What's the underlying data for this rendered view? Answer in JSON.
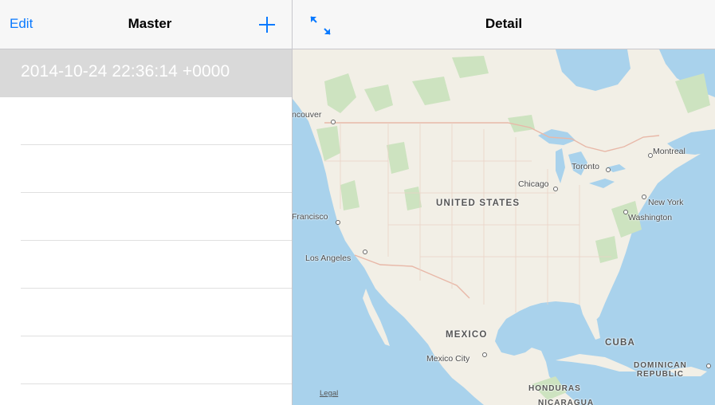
{
  "master": {
    "edit_label": "Edit",
    "title": "Master",
    "add_icon": "plus-icon",
    "rows": [
      {
        "label": "2014-10-24 22:36:14 +0000",
        "selected": true
      },
      {
        "label": ""
      },
      {
        "label": ""
      },
      {
        "label": ""
      },
      {
        "label": ""
      },
      {
        "label": ""
      },
      {
        "label": ""
      }
    ]
  },
  "detail": {
    "title": "Detail",
    "expand_icon": "expand-arrows-icon",
    "map": {
      "cities": {
        "vancouver": "ncouver",
        "montreal": "Montreal",
        "toronto": "Toronto",
        "chicago": "Chicago",
        "new_york": "New York",
        "washington": "Washington",
        "san_francisco": "Francisco",
        "los_angeles": "Los Angeles",
        "mexico_city": "Mexico City"
      },
      "countries": {
        "us": "UNITED STATES",
        "mexico": "MEXICO",
        "cuba": "CUBA",
        "dominican_line1": "DOMINICAN",
        "dominican_line2": "REPUBLIC",
        "honduras": "HONDURAS",
        "nicaragua": "NICARAGUA"
      },
      "legal_label": "Legal"
    }
  },
  "colors": {
    "tint": "#0a7aff",
    "selection": "#d9d9d9",
    "ocean": "#a9d2ec",
    "land": "#f2efe6"
  }
}
